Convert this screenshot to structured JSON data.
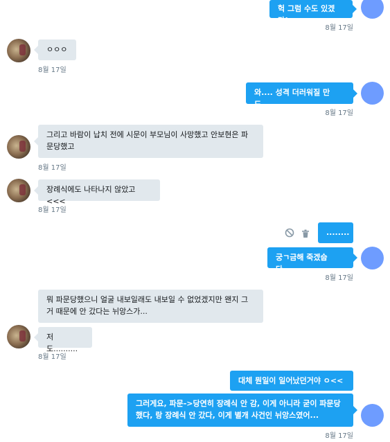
{
  "messages": [
    {
      "text": "헉 그럼 수도 있겠다!",
      "time": "8월 17일"
    },
    {
      "text": "ㅇㅇㅇ",
      "time": "8월 17일"
    },
    {
      "text": "와.... 성격 더러워질 만도....",
      "time": "8월 17일"
    },
    {
      "text": "그리고 바람이 납치 전에 시문이 부모님이 사망했고 안보현은 파문당했고",
      "time": "8월 17일"
    },
    {
      "text": "장례식에도 나타나지 않았고<<<",
      "time": "8월 17일"
    },
    {
      "text": "........"
    },
    {
      "text": "궁ㄱ금해 죽겠숩다....",
      "time": "8월 17일"
    },
    {
      "text": "뭐 파문당했으니 얼굴 내보일래도 내보일 수 없었겠지만 왠지 그거 때문에 안 갔다는 뉘앙스가..."
    },
    {
      "text": "저도..........",
      "time": "8월 17일"
    },
    {
      "text": "대체 뭔일이 일어났던거야 ㅇ<<"
    },
    {
      "text": "그러게요, 파문->당연히 장례식 안 감, 이게 아니라 굳이 파문당했다, 랑 장례식 안 갔다, 이게 별개 사건인 뉘앙스였어...",
      "time": "8월 17일"
    }
  ],
  "actions": {
    "block_icon": "block-icon",
    "delete_icon": "trash-icon"
  }
}
